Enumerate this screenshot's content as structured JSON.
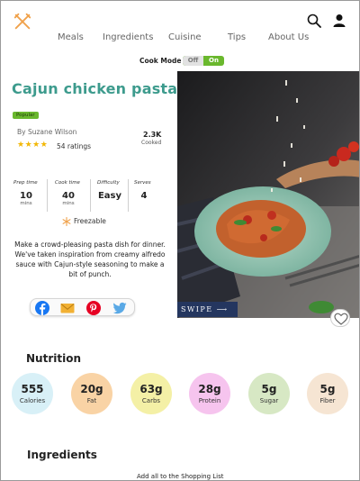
{
  "header": {
    "logo_icon": "crossed-fork-knife-icon",
    "search_icon": "search-icon",
    "user_icon": "user-icon",
    "nav": [
      "Meals",
      "Ingredients",
      "Cuisine",
      "Tips",
      "About Us"
    ]
  },
  "cook_mode": {
    "label": "Cook Mode",
    "off_label": "Off",
    "on_label": "On"
  },
  "recipe": {
    "title": "Cajun chicken pasta",
    "badge": "Popular",
    "author": "By Suzane Wilson",
    "rating_stars": "★★★★",
    "rating_value": 4,
    "ratings_text": "54 ratings",
    "cooked_count": "2.3K",
    "cooked_label": "Cooked",
    "stats": [
      {
        "label": "Prep time",
        "value": "10",
        "unit": "mins"
      },
      {
        "label": "Cook time",
        "value": "40",
        "unit": "mins"
      },
      {
        "label": "Difficulty",
        "value": "Easy",
        "unit": ""
      },
      {
        "label": "Serves",
        "value": "4",
        "unit": ""
      }
    ],
    "freezable": "Freezable",
    "description": "Make a crowd-pleasing pasta dish for dinner. We've taken inspiration from creamy alfredo sauce with Cajun-style seasoning to make a bit of punch."
  },
  "share": [
    "facebook-icon",
    "email-icon",
    "pinterest-icon",
    "twitter-icon"
  ],
  "photo": {
    "swipe_label": "SWIPE ⟶",
    "favorite_icon": "heart-icon"
  },
  "nutrition": {
    "title": "Nutrition",
    "items": [
      {
        "value": "555",
        "label": "Calories",
        "color": "#d8f0f7"
      },
      {
        "value": "20g",
        "label": "Fat",
        "color": "#f9d3a5"
      },
      {
        "value": "63g",
        "label": "Carbs",
        "color": "#f4f0a6"
      },
      {
        "value": "28g",
        "label": "Protein",
        "color": "#f6c4ee"
      },
      {
        "value": "5g",
        "label": "Sugar",
        "color": "#d7e8c4"
      },
      {
        "value": "5g",
        "label": "Fiber",
        "color": "#f6e5d3"
      }
    ]
  },
  "ingredients": {
    "title": "Ingredients",
    "add_all": "Add all to the Shopping List"
  },
  "colors": {
    "accent_teal": "#3d9b8d",
    "toggle_green": "#6ab82d",
    "star_gold": "#f2b705",
    "swipe_navy": "#24365f"
  }
}
